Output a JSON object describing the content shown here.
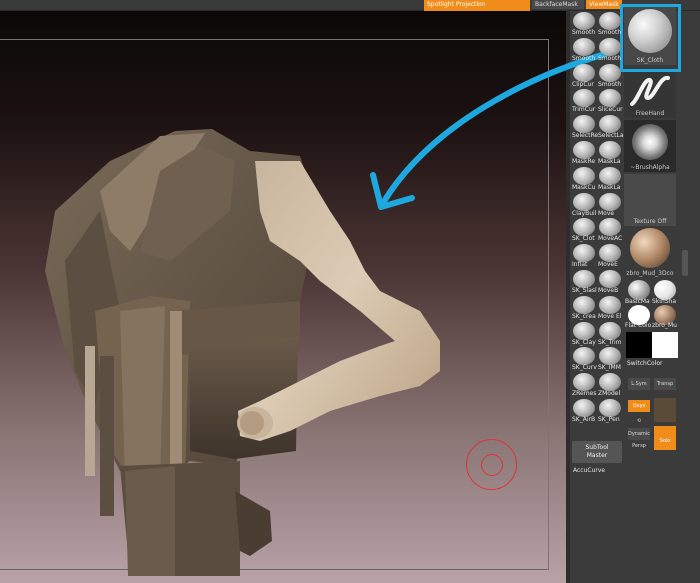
{
  "topbar": {
    "spotlight_label": "Spotlight Projection",
    "backface_label": "BackfaceMask",
    "viewmask_label": "ViewMask"
  },
  "brushes": [
    {
      "label": "Smooth",
      "name": "brush-smooth-1"
    },
    {
      "label": "Smooth",
      "name": "brush-smooth-2"
    },
    {
      "label": "Smooth",
      "name": "brush-smooth-3"
    },
    {
      "label": "Smooth",
      "name": "brush-smooth-4"
    },
    {
      "label": "ClipCur",
      "name": "brush-clipcurve"
    },
    {
      "label": "Smooth",
      "name": "brush-smooth-5"
    },
    {
      "label": "TrimCur",
      "name": "brush-trimcurve"
    },
    {
      "label": "SliceCur",
      "name": "brush-slicecurve"
    },
    {
      "label": "SelectRe",
      "name": "brush-selectrect"
    },
    {
      "label": "SelectLa",
      "name": "brush-selectlasso"
    },
    {
      "label": "MaskRe",
      "name": "brush-maskrect"
    },
    {
      "label": "MaskLa",
      "name": "brush-masklasso"
    },
    {
      "label": "MaskCu",
      "name": "brush-maskcurve"
    },
    {
      "label": "MaskLa",
      "name": "brush-masklasso-2"
    },
    {
      "label": "ClayBuil",
      "name": "brush-claybuildup"
    },
    {
      "label": "Move",
      "name": "brush-move"
    },
    {
      "label": "SK_Clot",
      "name": "brush-sk-cloth"
    },
    {
      "label": "MoveAC",
      "name": "brush-moveac"
    },
    {
      "label": "Inflat",
      "name": "brush-inflate"
    },
    {
      "label": "MoveE",
      "name": "brush-movee"
    },
    {
      "label": "SK_Slasl",
      "name": "brush-sk-slash"
    },
    {
      "label": "MoveB",
      "name": "brush-moveb"
    },
    {
      "label": "SK_crea",
      "name": "brush-sk-crease"
    },
    {
      "label": "Move El",
      "name": "brush-move-elastic"
    },
    {
      "label": "SK_Clay",
      "name": "brush-sk-clay"
    },
    {
      "label": "SK_Trim",
      "name": "brush-sk-trim"
    },
    {
      "label": "SK_Curv",
      "name": "brush-sk-curve"
    },
    {
      "label": "SK_IMM",
      "name": "brush-sk-imm"
    },
    {
      "label": "ZRemes",
      "name": "brush-zremesh"
    },
    {
      "label": "ZModel",
      "name": "brush-zmodeler"
    },
    {
      "label": "SK_AirB",
      "name": "brush-sk-airbrush"
    },
    {
      "label": "SK_Pen",
      "name": "brush-sk-pen"
    }
  ],
  "tiles": {
    "cloth_label": "SK_Cloth",
    "freehand_label": "FreeHand",
    "brushalpha_label": "~BrushAlpha",
    "texture_label": "Texture Off",
    "material_label": "zbro_Mud_3Dco"
  },
  "materials": [
    {
      "label": "BasicMa"
    },
    {
      "label": "SkinSha"
    },
    {
      "label": "Flat Colo"
    },
    {
      "label": "zbro_Mu"
    }
  ],
  "switch_color_label": "SwitchColor",
  "tools": {
    "lsym": "L.Sym",
    "transp": "Transp",
    "xyz": "Qxyz",
    "dynamic": "Dynamic",
    "persp": "Persp",
    "solo": "Solo"
  },
  "subtool": {
    "line1": "SubTool",
    "line2": "Master"
  },
  "accucurve_label": "AccuCurve",
  "colors": {
    "accent": "#f08c1a",
    "highlight": "#1ea8e0",
    "cursor": "#dd3333"
  }
}
